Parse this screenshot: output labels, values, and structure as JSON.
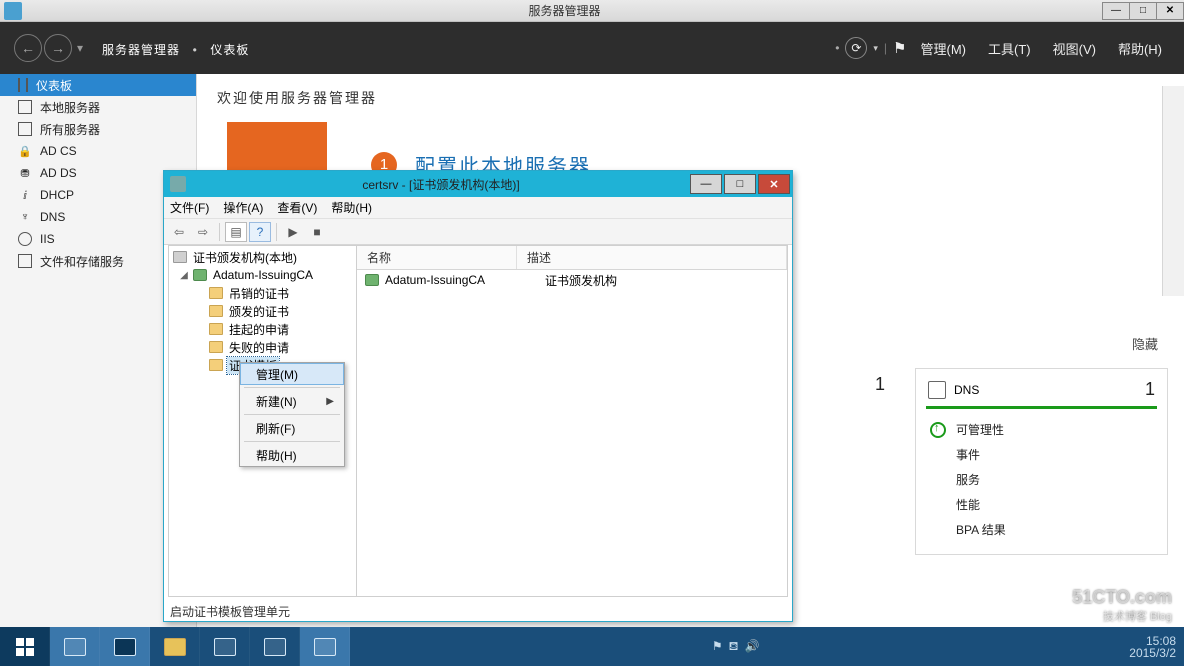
{
  "mainWindow": {
    "title": "服务器管理器",
    "breadcrumb": {
      "root": "服务器管理器",
      "current": "仪表板"
    },
    "menus": {
      "manage": "管理(M)",
      "tools": "工具(T)",
      "view": "视图(V)",
      "help": "帮助(H)"
    },
    "sidebar": [
      {
        "label": "仪表板",
        "icon": "dashboard"
      },
      {
        "label": "本地服务器",
        "icon": "server"
      },
      {
        "label": "所有服务器",
        "icon": "servers"
      },
      {
        "label": "AD CS",
        "icon": "adcs"
      },
      {
        "label": "AD DS",
        "icon": "adds"
      },
      {
        "label": "DHCP",
        "icon": "dhcp"
      },
      {
        "label": "DNS",
        "icon": "dns"
      },
      {
        "label": "IIS",
        "icon": "iis"
      },
      {
        "label": "文件和存储服务",
        "icon": "storage"
      }
    ],
    "welcome": "欢迎使用服务器管理器",
    "step1": {
      "num": "1",
      "text": "配置此本地服务器"
    },
    "hide": "隐藏",
    "tiles": {
      "left": {
        "count": "1"
      },
      "dns": {
        "title": "DNS",
        "count": "1",
        "lines": [
          "可管理性",
          "事件",
          "服务",
          "性能",
          "BPA 结果"
        ]
      }
    }
  },
  "mmc": {
    "title": "certsrv - [证书颁发机构(本地)]",
    "menus": {
      "file": "文件(F)",
      "action": "操作(A)",
      "view": "查看(V)",
      "help": "帮助(H)"
    },
    "tree": {
      "root": "证书颁发机构(本地)",
      "ca": "Adatum-IssuingCA",
      "children": [
        "吊销的证书",
        "颁发的证书",
        "挂起的申请",
        "失败的申请",
        "证书模板"
      ]
    },
    "list": {
      "cols": {
        "name": "名称",
        "desc": "描述"
      },
      "rows": [
        {
          "name": "Adatum-IssuingCA",
          "desc": "证书颁发机构"
        }
      ]
    },
    "status": "启动证书模板管理单元"
  },
  "contextMenu": {
    "items": [
      {
        "label": "管理(M)",
        "hl": true
      },
      {
        "label": "新建(N)",
        "sub": true
      },
      {
        "label": "刷新(F)"
      },
      {
        "label": "帮助(H)"
      }
    ]
  },
  "taskbar": {
    "time": "15:08",
    "date": "2015/3/2"
  },
  "watermark": {
    "big": "51CTO.com",
    "sub": "技术博客  Blog"
  }
}
